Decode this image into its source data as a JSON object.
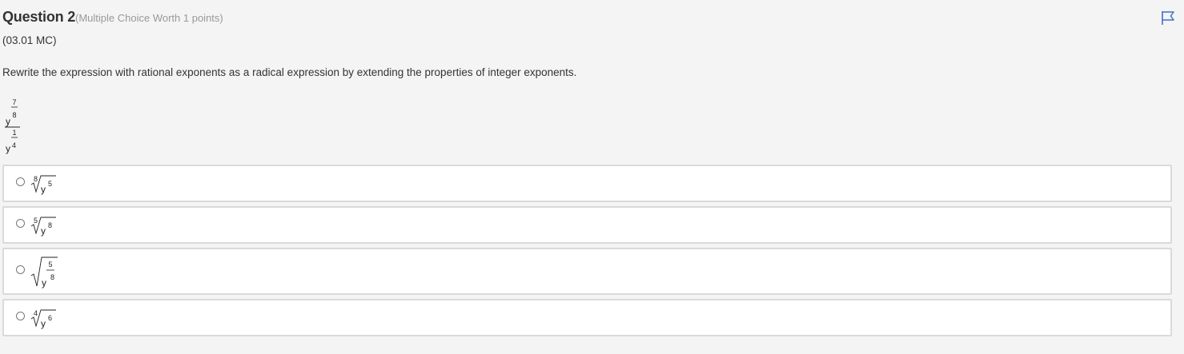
{
  "question": {
    "title": "Question 2",
    "worth": "(Multiple Choice Worth 1 points)",
    "code": "(03.01 MC)",
    "prompt": "Rewrite the expression with rational exponents as a radical expression by extending the properties of integer exponents.",
    "flag_icon": "flag-icon"
  },
  "expression": {
    "numerator": {
      "base": "y",
      "exp_num": "7",
      "exp_den": "8"
    },
    "denominator": {
      "base": "y",
      "exp_num": "1",
      "exp_den": "4"
    }
  },
  "choices": [
    {
      "type": "radical",
      "index": "8",
      "base": "y",
      "exponent": "5"
    },
    {
      "type": "radical",
      "index": "5",
      "base": "y",
      "exponent": "8"
    },
    {
      "type": "sqrt-fraction",
      "numerator": "5",
      "base": "y",
      "exponent": "8"
    },
    {
      "type": "radical",
      "index": "4",
      "base": "y",
      "exponent": "6"
    }
  ],
  "colors": {
    "background": "#f4f4f4",
    "choice_border": "#dadada",
    "flag": "#3f6fd1",
    "worth_text": "#999999"
  }
}
